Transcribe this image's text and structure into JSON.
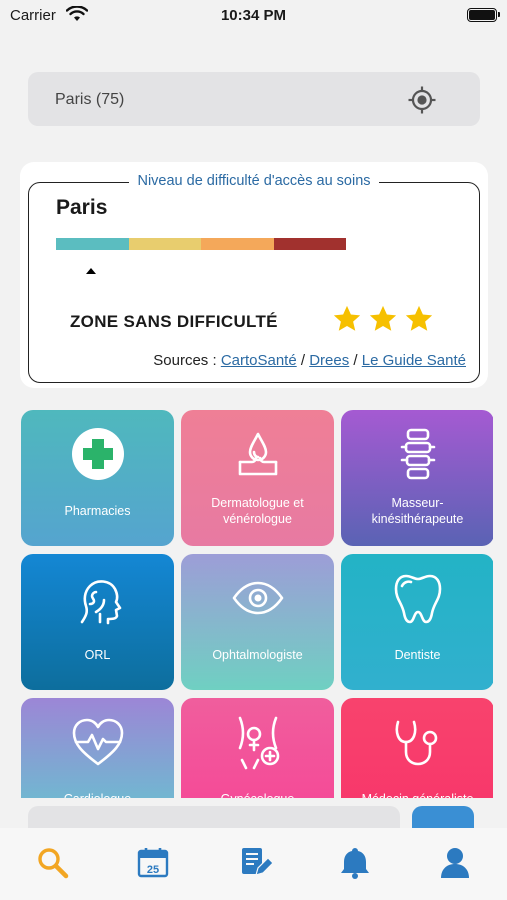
{
  "status_bar": {
    "carrier": "Carrier",
    "time": "10:34 PM"
  },
  "search": {
    "value": "Paris (75)",
    "icon": "locate-icon"
  },
  "access_card": {
    "legend": "Niveau de difficulté d'accès au soins",
    "city": "Paris",
    "scale_colors": [
      "#5bbdc0",
      "#e8cd6e",
      "#f4a85a",
      "#a1312e"
    ],
    "level": 0,
    "zone_label": "ZONE SANS DIFFICULTÉ",
    "stars": 3,
    "star_color": "#f6c000",
    "sources_label": "Sources :",
    "sources": [
      {
        "label": "CartoSanté"
      },
      {
        "label": "Drees"
      },
      {
        "label": "Le Guide Santé"
      }
    ],
    "separator": "/"
  },
  "categories": [
    {
      "label": "Pharmacies",
      "icon": "pharmacy-cross-icon"
    },
    {
      "label": "Dermatologue et vénérologue",
      "icon": "skin-drop-icon"
    },
    {
      "label": "Masseur-kinésithérapeute",
      "icon": "spine-icon"
    },
    {
      "label": "ORL",
      "icon": "ear-nose-throat-icon"
    },
    {
      "label": "Ophtalmologiste",
      "icon": "eye-icon"
    },
    {
      "label": "Dentiste",
      "icon": "tooth-icon"
    },
    {
      "label": "Cardiologue",
      "icon": "heart-pulse-icon"
    },
    {
      "label": "Gynécologue",
      "icon": "female-body-icon"
    },
    {
      "label": "Médecin généraliste",
      "icon": "stethoscope-icon"
    }
  ],
  "tabbar": {
    "items": [
      {
        "name": "search",
        "icon": "search-icon",
        "active": true
      },
      {
        "name": "calendar",
        "icon": "calendar-icon",
        "day": "25"
      },
      {
        "name": "documents",
        "icon": "document-edit-icon"
      },
      {
        "name": "notifications",
        "icon": "bell-icon"
      },
      {
        "name": "profile",
        "icon": "user-icon"
      }
    ],
    "active_color": "#f2a623",
    "inactive_color": "#2c7ac0"
  }
}
